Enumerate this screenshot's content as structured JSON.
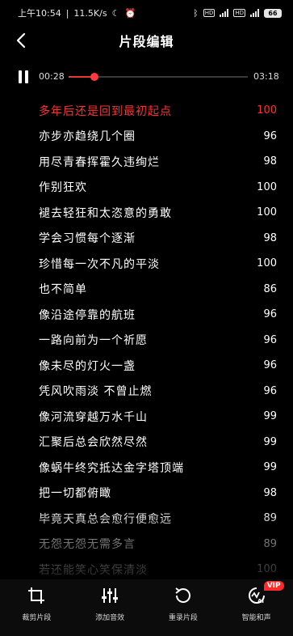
{
  "status_bar": {
    "time": "上午10:54",
    "net_speed": "11.5K/s",
    "battery": "66"
  },
  "header": {
    "title": "片段编辑"
  },
  "player": {
    "current_time": "00:28",
    "total_time": "03:18",
    "progress": 0.143
  },
  "lyrics": [
    {
      "text": "多年后还是回到最初起点",
      "score": "100",
      "active": true
    },
    {
      "text": "亦步亦趋绕几个圈",
      "score": "96"
    },
    {
      "text": "用尽青春挥霍久违绚烂",
      "score": "98"
    },
    {
      "text": "作别狂欢",
      "score": "100"
    },
    {
      "text": "褪去轻狂和太恣意的勇敢",
      "score": "100"
    },
    {
      "text": "学会习惯每个逐渐",
      "score": "98"
    },
    {
      "text": "珍惜每一次不凡的平淡",
      "score": "100"
    },
    {
      "text": "也不简单",
      "score": "86"
    },
    {
      "text": "像沿途停靠的航班",
      "score": "96"
    },
    {
      "text": "一路向前为一个祈愿",
      "score": "96"
    },
    {
      "text": "像未尽的灯火一盏",
      "score": "96"
    },
    {
      "text": "凭风吹雨淡 不曾止燃",
      "score": "96"
    },
    {
      "text": "像河流穿越万水千山",
      "score": "99"
    },
    {
      "text": "汇聚后总会欣然尽然",
      "score": "99"
    },
    {
      "text": "像蜗牛终究抵达金字塔顶端",
      "score": "99"
    },
    {
      "text": "把一切都俯瞰",
      "score": "98"
    },
    {
      "text": "毕竟天真总会愈行便愈远",
      "score": "89"
    },
    {
      "text": "无怨无怨无需多言",
      "score": "89"
    },
    {
      "text": "若还能笑心笑保清淡",
      "score": "100"
    }
  ],
  "toolbar": [
    {
      "label": "裁剪片段",
      "icon": "crop-icon"
    },
    {
      "label": "添加音效",
      "icon": "sliders-icon"
    },
    {
      "label": "重录片段",
      "icon": "rerecord-icon"
    },
    {
      "label": "智能和声",
      "icon": "ai-harmony-icon",
      "badge": "VIP"
    }
  ],
  "colors": {
    "accent": "#ff3030",
    "background": "#000000",
    "text": "#ffffff"
  }
}
